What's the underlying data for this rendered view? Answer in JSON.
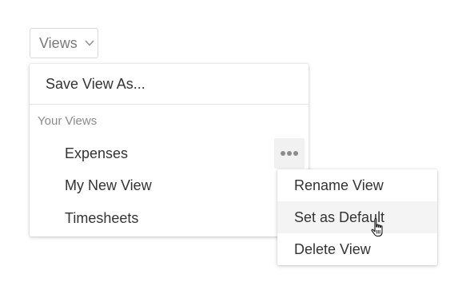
{
  "views_dropdown": {
    "label": "Views",
    "icon": "chevron-down-icon"
  },
  "menu": {
    "save_as_label": "Save View As...",
    "section_label": "Your Views",
    "views": [
      "Expenses",
      "My New View",
      "Timesheets"
    ],
    "more_icon": "more-horizontal-icon"
  },
  "context_menu": {
    "items": [
      "Rename View",
      "Set as Default",
      "Delete View"
    ],
    "hovered_item": "Set as Default"
  },
  "colors": {
    "text": "#333333",
    "muted": "#8a8a8a",
    "border": "#d9d9d9",
    "hover_bg": "#f4f4f4",
    "icon": "#8c8c8c"
  }
}
